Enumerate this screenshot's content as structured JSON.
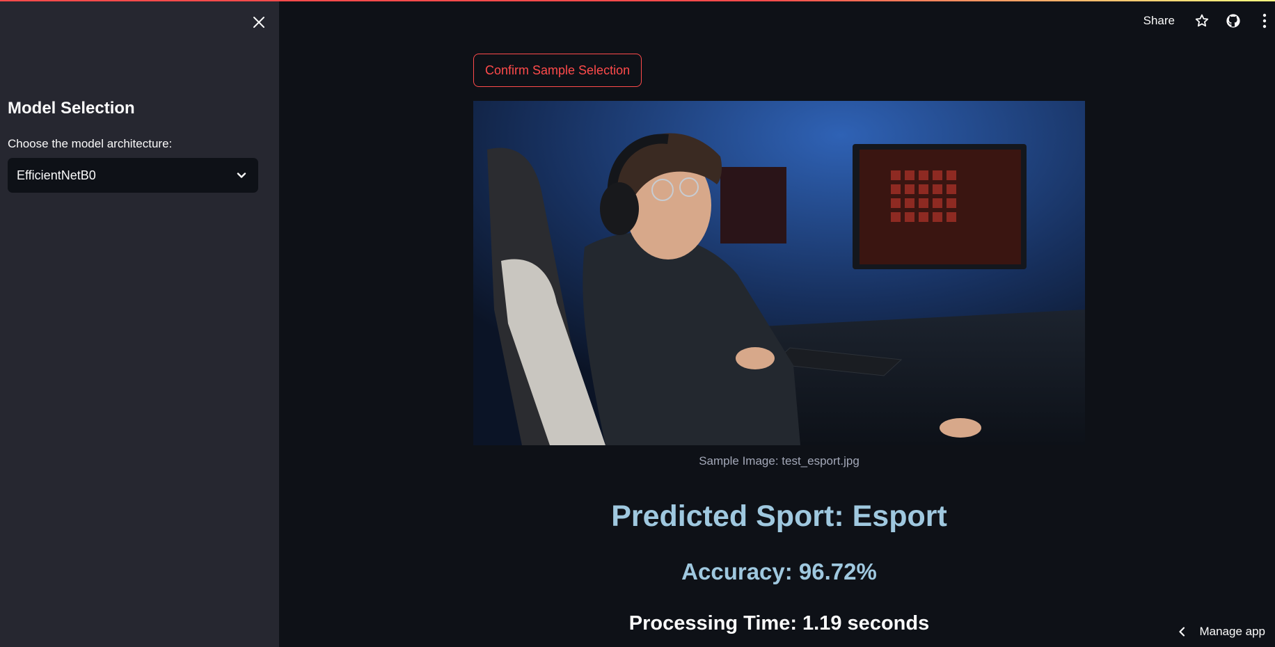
{
  "sidebar": {
    "title": "Model Selection",
    "select_label": "Choose the model architecture:",
    "select_value": "EfficientNetB0",
    "close_icon": "close-icon",
    "dropdown_icon": "chevron-down-icon"
  },
  "header": {
    "share_label": "Share",
    "icons": [
      "star-icon",
      "github-icon",
      "more-vertical-icon"
    ]
  },
  "main": {
    "confirm_button": "Confirm Sample Selection",
    "image_caption": "Sample Image: test_esport.jpg",
    "predicted": "Predicted Sport: Esport",
    "accuracy": "Accuracy: 96.72%",
    "processing_time": "Processing Time: 1.19 seconds"
  },
  "footer": {
    "manage_label": "Manage app"
  },
  "colors": {
    "accent": "#ff4b4b",
    "background": "#0e1117",
    "sidebar": "#262730",
    "prediction_text": "#9fc8df"
  }
}
